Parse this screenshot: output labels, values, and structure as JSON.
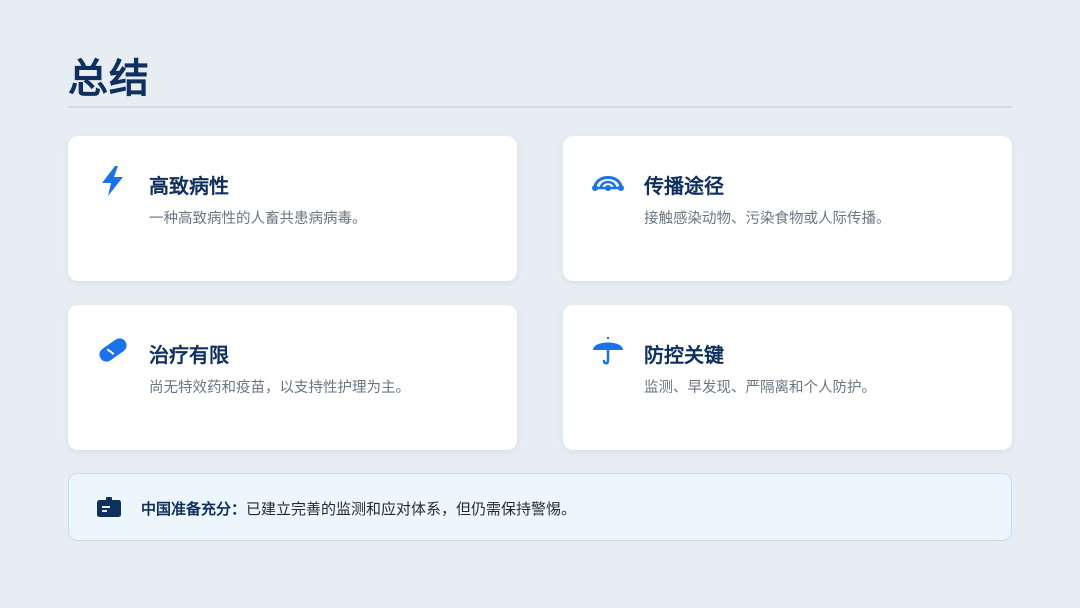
{
  "page": {
    "title": "总结"
  },
  "colors": {
    "accent": "#1a73e8",
    "title_text": "#0f2f5c",
    "background": "#e8edf3"
  },
  "cards": [
    {
      "icon": "lightning-bolt-icon",
      "title": "高致病性",
      "description": "一种高致病性的人畜共患病病毒。"
    },
    {
      "icon": "transmission-arc-icon",
      "title": "传播途径",
      "description": "接触感染动物、污染食物或人际传播。"
    },
    {
      "icon": "pill-capsule-icon",
      "title": "治疗有限",
      "description": "尚无特效药和疫苗，以支持性护理为主。"
    },
    {
      "icon": "umbrella-icon",
      "title": "防控关键",
      "description": "监测、早发现、严隔离和个人防护。"
    }
  ],
  "footer": {
    "icon": "id-card-icon",
    "label": "中国准备充分：",
    "text": "已建立完善的监测和应对体系，但仍需保持警惕。"
  }
}
